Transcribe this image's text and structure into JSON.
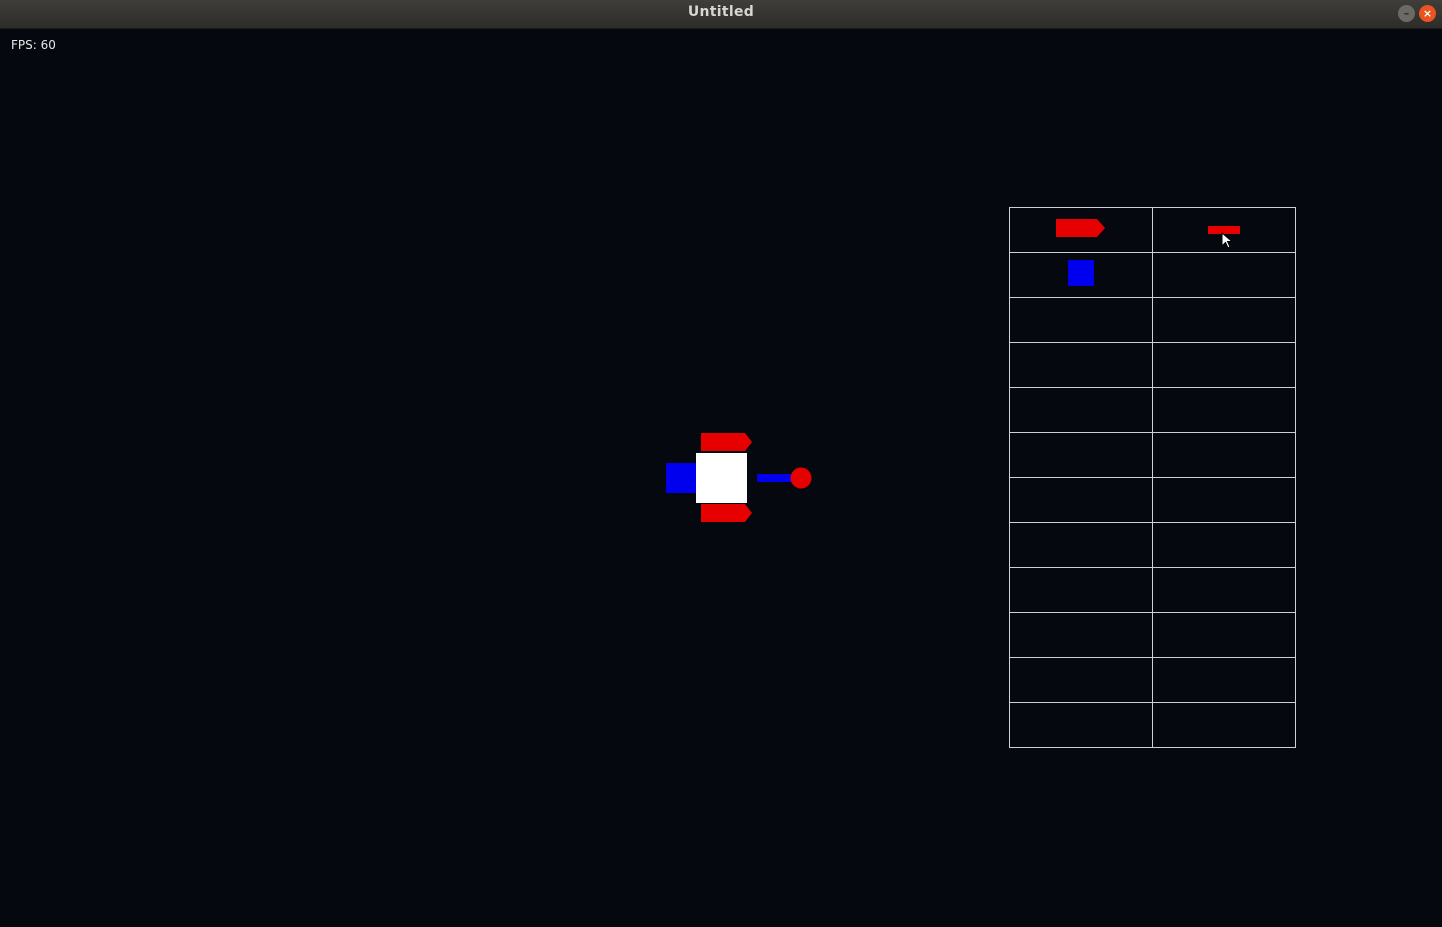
{
  "window": {
    "title": "Untitled",
    "minimize_icon": "minimize-icon",
    "close_icon": "close-icon"
  },
  "hud": {
    "fps_text": "FPS: 60"
  },
  "colors": {
    "background": "#05080f",
    "red": "#e60000",
    "blue": "#0000ee",
    "white": "#ffffff",
    "grid": "#d0d0d0"
  },
  "ship": {
    "parts": [
      "white-core",
      "blue-rear-block",
      "red-top-thruster",
      "red-bottom-thruster",
      "blue-arm",
      "red-orb"
    ]
  },
  "inventory": {
    "rows": 12,
    "columns": 2,
    "slots": [
      {
        "row": 0,
        "col": 0,
        "item": "red-arrow-part"
      },
      {
        "row": 0,
        "col": 1,
        "item": "red-bar-part"
      },
      {
        "row": 1,
        "col": 0,
        "item": "blue-square-part"
      }
    ]
  }
}
